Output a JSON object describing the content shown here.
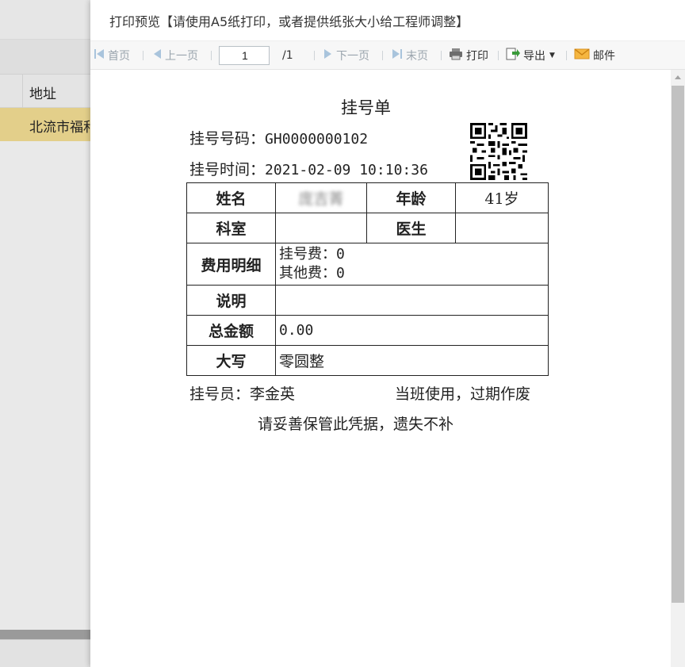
{
  "background": {
    "column_header": "地址",
    "row_value": "北流市福和"
  },
  "dialog": {
    "title": "打印预览【请使用A5纸打印，或者提供纸张大小给工程师调整】"
  },
  "toolbar": {
    "first": "首页",
    "prev": "上一页",
    "page_value": "1",
    "page_total": "/1",
    "next": "下一页",
    "last": "末页",
    "print": "打印",
    "export": "导出",
    "mail": "邮件"
  },
  "receipt": {
    "title": "挂号单",
    "number_label": "挂号号码：",
    "number_value": "GH0000000102",
    "time_label": "挂号时间：",
    "time_value": "2021-02-09 10:10:36",
    "name_label": "姓名",
    "name_value": "庞吉菁",
    "age_label": "年龄",
    "age_value": "41岁",
    "dept_label": "科室",
    "dept_value": "",
    "doctor_label": "医生",
    "doctor_value": "",
    "fee_label": "费用明细",
    "fee_line1": "挂号费：0",
    "fee_line2": "其他费：0",
    "note_label": "说明",
    "note_value": "",
    "total_label": "总金额",
    "total_value": "0.00",
    "upper_label": "大写",
    "upper_value": "零圆整",
    "clerk": "挂号员：李金英",
    "valid_note": "当班使用，过期作废",
    "keep_note": "请妥善保管此凭据，遗失不补"
  },
  "colors": {
    "selected_row": "#e3cf8a",
    "toolbar_icon": "#5b9bd5",
    "export_icon": "#3a9a3a",
    "mail_icon": "#f0a020"
  }
}
